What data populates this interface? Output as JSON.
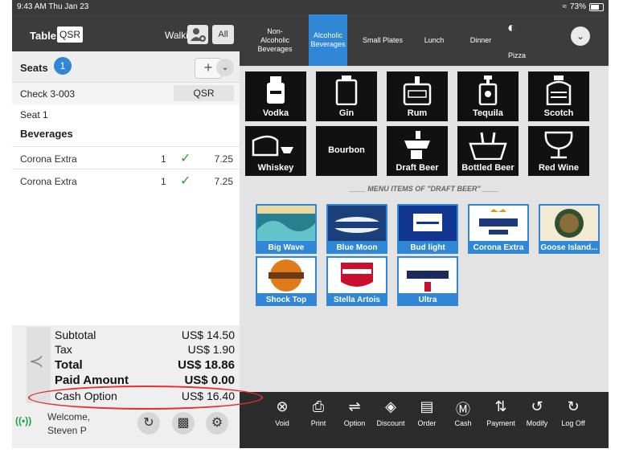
{
  "status_bar": {
    "time": "9:43 AM  Thu Jan 23",
    "battery": "73%"
  },
  "order": {
    "table_label": "Table",
    "table_value": "QSR",
    "guest_type": "Walkin",
    "all_label": "All",
    "seats_label": "Seats",
    "seat_count": "1",
    "check_label": "Check 3-003",
    "check_type": "QSR",
    "seat_header": "Seat 1",
    "category_header": "Beverages",
    "items": [
      {
        "name": "Corona Extra",
        "qty": "1",
        "price": "7.25"
      },
      {
        "name": "Corona Extra",
        "qty": "1",
        "price": "7.25"
      }
    ]
  },
  "totals": {
    "subtotal_label": "Subtotal",
    "subtotal": "US$ 14.50",
    "tax_label": "Tax",
    "tax": "US$ 1.90",
    "total_label": "Total",
    "total": "US$ 18.86",
    "paid_label": "Paid Amount",
    "paid": "US$ 0.00",
    "cash_label": "Cash Option",
    "cash": "US$ 16.40"
  },
  "footer": {
    "welcome_line1": "Welcome,",
    "welcome_line2": "Steven P"
  },
  "categories": [
    {
      "line1": "Non-",
      "line2": "Alcoholic",
      "line3": "Beverages"
    },
    {
      "line1": "Alcoholic",
      "line2": "Beverages"
    },
    {
      "line1": "Small Plates"
    },
    {
      "line1": "Lunch"
    },
    {
      "line1": "Dinner"
    }
  ],
  "pizza_label": "Pizza",
  "spirits": [
    "Vodka",
    "Gin",
    "Rum",
    "Tequila",
    "Scotch",
    "Whiskey",
    "Bourbon",
    "Draft Beer",
    "Bottled Beer",
    "Red Wine"
  ],
  "section_label": "____ MENU ITEMS OF \"DRAFT BEER\" ____",
  "beers": [
    "Big Wave",
    "Blue Moon",
    "Bud light",
    "Corona Extra",
    "Goose Island...",
    "Shock Top",
    "Stella Artois",
    "Ultra"
  ],
  "actions": [
    "Void",
    "Print",
    "Option",
    "Discount",
    "Order",
    "Cash",
    "Payment",
    "Modify",
    "Log Off"
  ],
  "colors": {
    "accent": "#2f87d6",
    "highlight": "#e53030",
    "check": "#2ca02c"
  }
}
